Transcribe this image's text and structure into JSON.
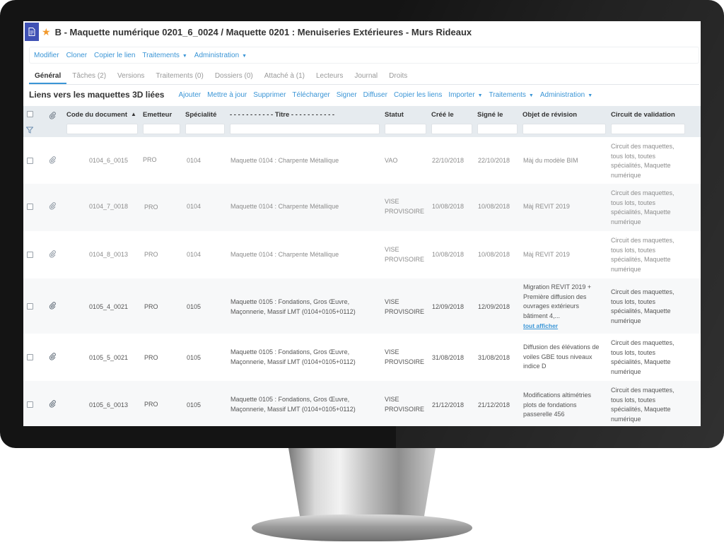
{
  "header": {
    "title": "B - Maquette numérique 0201_6_0024 / Maquette 0201 : Menuiseries Extérieures - Murs Rideaux"
  },
  "actions": {
    "modifier": "Modifier",
    "cloner": "Cloner",
    "copier_lien": "Copier le lien",
    "traitements": "Traitements",
    "administration": "Administration"
  },
  "tabs": [
    {
      "label": "Général"
    },
    {
      "label": "Tâches (2)"
    },
    {
      "label": "Versions"
    },
    {
      "label": "Traitements (0)"
    },
    {
      "label": "Dossiers (0)"
    },
    {
      "label": "Attaché à (1)"
    },
    {
      "label": "Lecteurs"
    },
    {
      "label": "Journal"
    },
    {
      "label": "Droits"
    }
  ],
  "section": {
    "title": "Liens vers les maquettes 3D liées",
    "actions": {
      "ajouter": "Ajouter",
      "mettre_a_jour": "Mettre à jour",
      "supprimer": "Supprimer",
      "telecharger": "Télécharger",
      "signer": "Signer",
      "diffuser": "Diffuser",
      "copier_liens": "Copier les liens",
      "importer": "Importer",
      "traitements": "Traitements",
      "administration": "Administration"
    }
  },
  "columns": {
    "code": "Code du document",
    "emetteur": "Emetteur",
    "specialite": "Spécialité",
    "titre": "- - - - - - - - - - - Titre - - - - - - - - - - -",
    "statut": "Statut",
    "cree": "Créé le",
    "signe": "Signé le",
    "objet": "Objet de révision",
    "circuit": "Circuit de validation"
  },
  "rows": [
    {
      "code": "0104_6_0015",
      "emetteur": "PRO",
      "specialite": "0104",
      "titre": "Maquette 0104 : Charpente Métallique",
      "statut": "VAO",
      "cree": "22/10/2018",
      "signe": "22/10/2018",
      "objet": "Màj du modèle BIM",
      "circuit": "Circuit des maquettes, tous lots, toutes spécialités, Maquette numérique"
    },
    {
      "code": "0104_7_0018",
      "emetteur": "PRO",
      "specialite": "0104",
      "titre": "Maquette 0104 : Charpente Métallique",
      "statut": "VISE PROVISOIRE",
      "cree": "10/08/2018",
      "signe": "10/08/2018",
      "objet": "Màj REVIT 2019",
      "circuit": "Circuit des maquettes, tous lots, toutes spécialités, Maquette numérique"
    },
    {
      "code": "0104_8_0013",
      "emetteur": "PRO",
      "specialite": "0104",
      "titre": "Maquette 0104 : Charpente Métallique",
      "statut": "VISE PROVISOIRE",
      "cree": "10/08/2018",
      "signe": "10/08/2018",
      "objet": "Màj REVIT 2019",
      "circuit": "Circuit des maquettes, tous lots, toutes spécialités, Maquette numérique"
    },
    {
      "code": "0105_4_0021",
      "emetteur": "PRO",
      "specialite": "0105",
      "titre": "Maquette 0105 : Fondations, Gros Œuvre, Maçonnerie, Massif LMT (0104+0105+0112)",
      "statut": "VISE PROVISOIRE",
      "cree": "12/09/2018",
      "signe": "12/09/2018",
      "objet": "Migration REVIT 2019 + Première diffusion des ouvrages extérieurs bâtiment 4,...",
      "more": "tout afficher",
      "circuit": "Circuit des maquettes, tous lots, toutes spécialités, Maquette numérique"
    },
    {
      "code": "0105_5_0021",
      "emetteur": "PRO",
      "specialite": "0105",
      "titre": "Maquette 0105 : Fondations, Gros Œuvre, Maçonnerie, Massif LMT (0104+0105+0112)",
      "statut": "VISE PROVISOIRE",
      "cree": "31/08/2018",
      "signe": "31/08/2018",
      "objet": "Diffusion des élévations de voiles GBE tous niveaux indice D",
      "circuit": "Circuit des maquettes, tous lots, toutes spécialités, Maquette numérique"
    },
    {
      "code": "0105_6_0013",
      "emetteur": "PRO",
      "specialite": "0105",
      "titre": "Maquette 0105 : Fondations, Gros Œuvre, Maçonnerie, Massif LMT (0104+0105+0112)",
      "statut": "VISE PROVISOIRE",
      "cree": "21/12/2018",
      "signe": "21/12/2018",
      "objet": "Modifications altimétries plots de fondations passerelle 456",
      "circuit": "Circuit des maquettes, tous lots, toutes spécialités, Maquette numérique"
    }
  ]
}
